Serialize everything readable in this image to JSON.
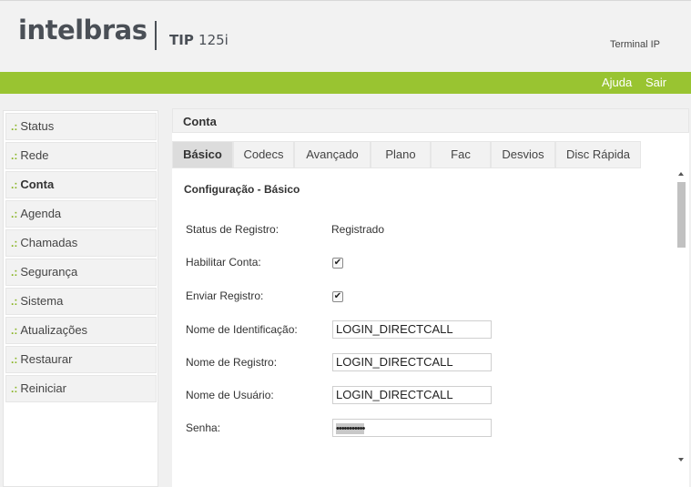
{
  "header": {
    "logo": "intelbras",
    "model": "TIP",
    "model_number": "125i",
    "device_type": "Terminal IP"
  },
  "topbar": {
    "help": "Ajuda",
    "logout": "Sair"
  },
  "sidebar": {
    "bullet": ".:",
    "items": [
      {
        "label": "Status"
      },
      {
        "label": "Rede"
      },
      {
        "label": "Conta"
      },
      {
        "label": "Agenda"
      },
      {
        "label": "Chamadas"
      },
      {
        "label": "Segurança"
      },
      {
        "label": "Sistema"
      },
      {
        "label": "Atualizações"
      },
      {
        "label": "Restaurar"
      },
      {
        "label": "Reiniciar"
      }
    ],
    "active": "Conta"
  },
  "main": {
    "title": "Conta",
    "tabs": [
      {
        "label": "Básico"
      },
      {
        "label": "Codecs"
      },
      {
        "label": "Avançado"
      },
      {
        "label": "Plano"
      },
      {
        "label": "Fac"
      },
      {
        "label": "Desvios"
      },
      {
        "label": "Disc Rápida"
      }
    ],
    "active_tab": "Básico",
    "section_title": "Configuração - Básico",
    "form": {
      "status_label": "Status de Registro:",
      "status_value": "Registrado",
      "enable_label": "Habilitar Conta:",
      "enable_checked": true,
      "send_reg_label": "Enviar Registro:",
      "send_reg_checked": true,
      "check_mark": "✔",
      "display_name_label": "Nome de Identificação:",
      "display_name_value": "LOGIN_DIRECTCALL",
      "reg_name_label": "Nome de Registro:",
      "reg_name_value": "LOGIN_DIRECTCALL",
      "user_name_label": "Nome de Usuário:",
      "user_name_value": "LOGIN_DIRECTCALL",
      "password_label": "Senha:",
      "password_value": "•••••••••••"
    }
  },
  "colors": {
    "accent_green": "#99c431",
    "bullet_green": "#8ab526",
    "logo_gray": "#4a4f56"
  }
}
